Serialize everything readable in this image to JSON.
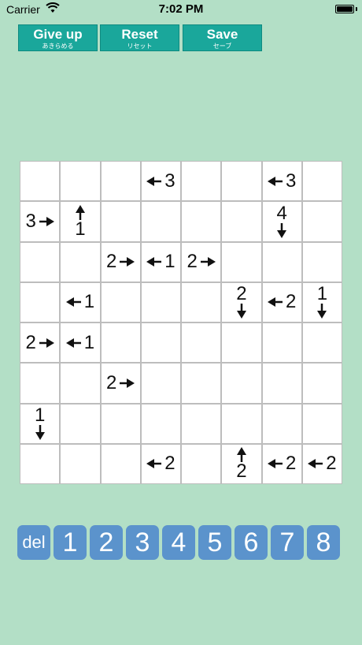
{
  "status": {
    "carrier": "Carrier",
    "time": "7:02 PM"
  },
  "buttons": {
    "give_up": {
      "label": "Give up",
      "sub": "あきらめる"
    },
    "reset": {
      "label": "Reset",
      "sub": "リセット"
    },
    "save": {
      "label": "Save",
      "sub": "セーブ"
    }
  },
  "grid_size": 8,
  "clues": [
    {
      "row": 0,
      "col": 3,
      "num": "3",
      "dir": "left"
    },
    {
      "row": 0,
      "col": 6,
      "num": "3",
      "dir": "left"
    },
    {
      "row": 1,
      "col": 0,
      "num": "3",
      "dir": "right"
    },
    {
      "row": 1,
      "col": 1,
      "num": "1",
      "dir": "up"
    },
    {
      "row": 1,
      "col": 6,
      "num": "4",
      "dir": "down"
    },
    {
      "row": 2,
      "col": 2,
      "num": "2",
      "dir": "right"
    },
    {
      "row": 2,
      "col": 3,
      "num": "1",
      "dir": "left"
    },
    {
      "row": 2,
      "col": 4,
      "num": "2",
      "dir": "right"
    },
    {
      "row": 3,
      "col": 1,
      "num": "1",
      "dir": "left"
    },
    {
      "row": 3,
      "col": 5,
      "num": "2",
      "dir": "down"
    },
    {
      "row": 3,
      "col": 6,
      "num": "2",
      "dir": "left"
    },
    {
      "row": 3,
      "col": 7,
      "num": "1",
      "dir": "down"
    },
    {
      "row": 4,
      "col": 0,
      "num": "2",
      "dir": "right"
    },
    {
      "row": 4,
      "col": 1,
      "num": "1",
      "dir": "left"
    },
    {
      "row": 5,
      "col": 2,
      "num": "2",
      "dir": "right"
    },
    {
      "row": 6,
      "col": 0,
      "num": "1",
      "dir": "down"
    },
    {
      "row": 7,
      "col": 3,
      "num": "2",
      "dir": "left"
    },
    {
      "row": 7,
      "col": 5,
      "num": "2",
      "dir": "up"
    },
    {
      "row": 7,
      "col": 6,
      "num": "2",
      "dir": "left"
    },
    {
      "row": 7,
      "col": 7,
      "num": "2",
      "dir": "left"
    }
  ],
  "pad": [
    "del",
    "1",
    "2",
    "3",
    "4",
    "5",
    "6",
    "7",
    "8"
  ]
}
